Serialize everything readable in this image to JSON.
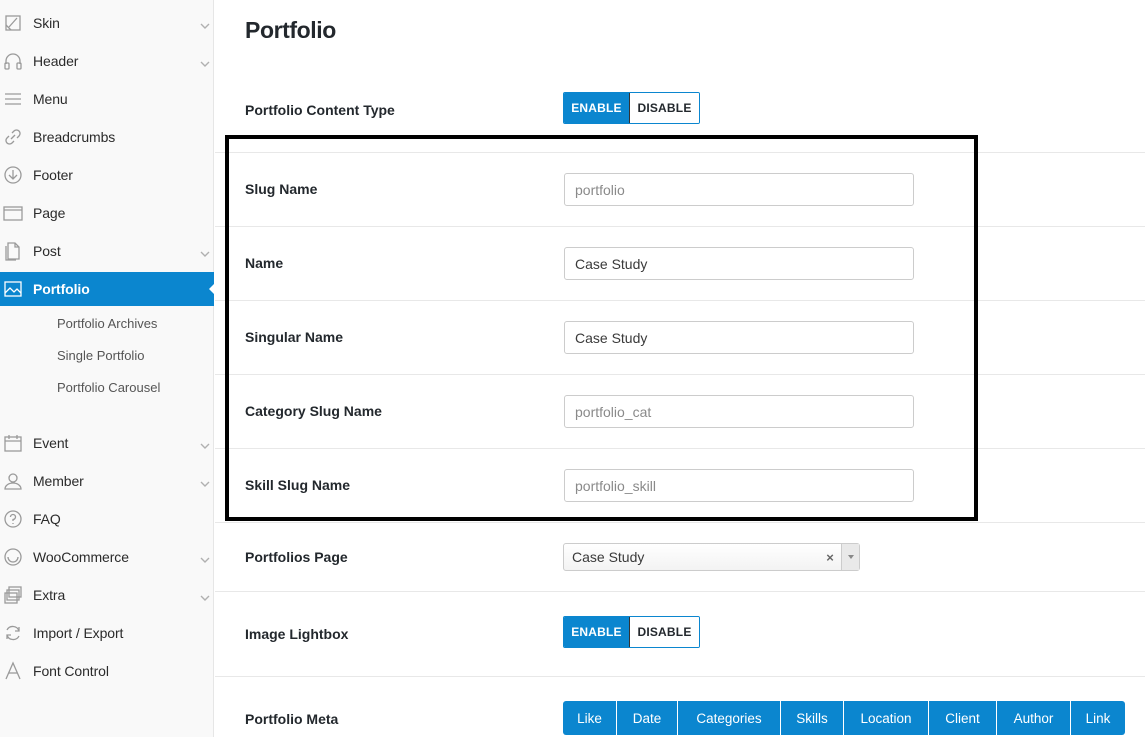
{
  "sidebar": {
    "items": [
      {
        "label": "Skin",
        "icon": "paint-icon",
        "has_chevron": true
      },
      {
        "label": "Header",
        "icon": "headphones-icon",
        "has_chevron": true
      },
      {
        "label": "Menu",
        "icon": "menu-lines-icon",
        "has_chevron": false
      },
      {
        "label": "Breadcrumbs",
        "icon": "link-icon",
        "has_chevron": false
      },
      {
        "label": "Footer",
        "icon": "arrow-down-circle-icon",
        "has_chevron": false
      },
      {
        "label": "Page",
        "icon": "page-icon",
        "has_chevron": false
      },
      {
        "label": "Post",
        "icon": "documents-icon",
        "has_chevron": true
      },
      {
        "label": "Portfolio",
        "icon": "image-icon",
        "active": true
      },
      {
        "label": "Event",
        "icon": "calendar-icon",
        "has_chevron": true
      },
      {
        "label": "Member",
        "icon": "user-icon",
        "has_chevron": true
      },
      {
        "label": "FAQ",
        "icon": "question-circle-icon",
        "has_chevron": false
      },
      {
        "label": "WooCommerce",
        "icon": "woocommerce-icon",
        "has_chevron": true
      },
      {
        "label": "Extra",
        "icon": "layers-icon",
        "has_chevron": true
      },
      {
        "label": "Import / Export",
        "icon": "refresh-icon",
        "has_chevron": false
      },
      {
        "label": "Font Control",
        "icon": "font-icon",
        "has_chevron": false
      }
    ],
    "subitems": [
      "Portfolio Archives",
      "Single Portfolio",
      "Portfolio Carousel"
    ]
  },
  "main": {
    "title": "Portfolio",
    "content_type": {
      "label": "Portfolio Content Type",
      "enable": "ENABLE",
      "disable": "DISABLE",
      "selected": "ENABLE"
    },
    "fields": [
      {
        "label": "Slug Name",
        "value": "",
        "placeholder": "portfolio"
      },
      {
        "label": "Name",
        "value": "Case Study",
        "placeholder": ""
      },
      {
        "label": "Singular Name",
        "value": "Case Study",
        "placeholder": ""
      },
      {
        "label": "Category Slug Name",
        "value": "",
        "placeholder": "portfolio_cat"
      },
      {
        "label": "Skill Slug Name",
        "value": "",
        "placeholder": "portfolio_skill"
      }
    ],
    "portfolios_page": {
      "label": "Portfolios Page",
      "value": "Case Study",
      "clear": "×"
    },
    "image_lightbox": {
      "label": "Image Lightbox",
      "enable": "ENABLE",
      "disable": "DISABLE",
      "selected": "ENABLE"
    },
    "portfolio_meta": {
      "label": "Portfolio Meta",
      "options": [
        "Like",
        "Date",
        "Categories",
        "Skills",
        "Location",
        "Client",
        "Author",
        "Link"
      ]
    }
  },
  "colors": {
    "accent": "#0b86cf",
    "highlight_border": "#000000"
  }
}
